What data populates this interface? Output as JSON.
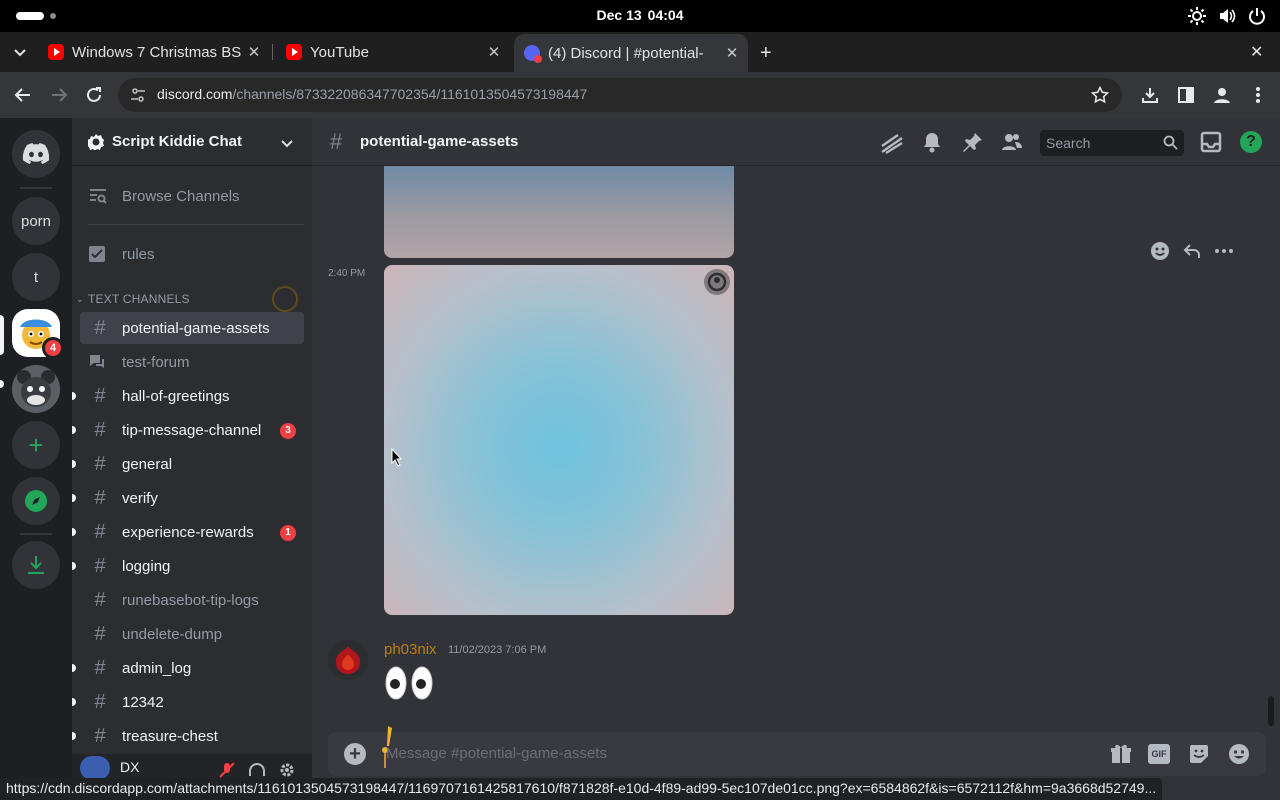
{
  "os": {
    "date": "Dec 13",
    "time": "04:04"
  },
  "browser": {
    "tabs": [
      {
        "title": "Windows 7 Christmas BS"
      },
      {
        "title": "YouTube"
      },
      {
        "title": "(4) Discord | #potential-"
      }
    ],
    "url_host": "discord.com",
    "url_path": "/channels/873322086347702354/1161013504573198447",
    "status_url": "https://cdn.discordapp.com/attachments/1161013504573198447/1169707161425817610/f871828f-e10d-4f89-ad99-5ec107de01cc.png?ex=6584862f&is=6572112f&hm=9a3668d52749..."
  },
  "guilds": [
    {
      "label": "porn"
    },
    {
      "label": "t"
    },
    {
      "badge": "4"
    }
  ],
  "server": {
    "name": "Script Kiddie Chat",
    "browse_channels": "Browse Channels",
    "rules": "rules",
    "category": "TEXT CHANNELS",
    "channels": [
      {
        "name": "potential-game-assets"
      },
      {
        "name": "test-forum"
      },
      {
        "name": "hall-of-greetings"
      },
      {
        "name": "tip-message-channel",
        "badge": "3"
      },
      {
        "name": "general"
      },
      {
        "name": "verify"
      },
      {
        "name": "experience-rewards",
        "badge": "1"
      },
      {
        "name": "logging"
      },
      {
        "name": "runebasebot-tip-logs"
      },
      {
        "name": "undelete-dump"
      },
      {
        "name": "admin_log"
      },
      {
        "name": "12342"
      },
      {
        "name": "treasure-chest"
      }
    ],
    "user": "DX"
  },
  "channel": {
    "name": "potential-game-assets",
    "search_placeholder": "Search",
    "message_placeholder": "Message #potential-game-assets"
  },
  "messages": {
    "timestamp_short": "2:40 PM",
    "author": "ph03nix",
    "author_timestamp": "11/02/2023 7:06 PM",
    "author_color": "#c27c0e"
  },
  "colors": {
    "badge_red": "#f23f43",
    "green": "#23a55a",
    "blurple": "#5865f2"
  }
}
